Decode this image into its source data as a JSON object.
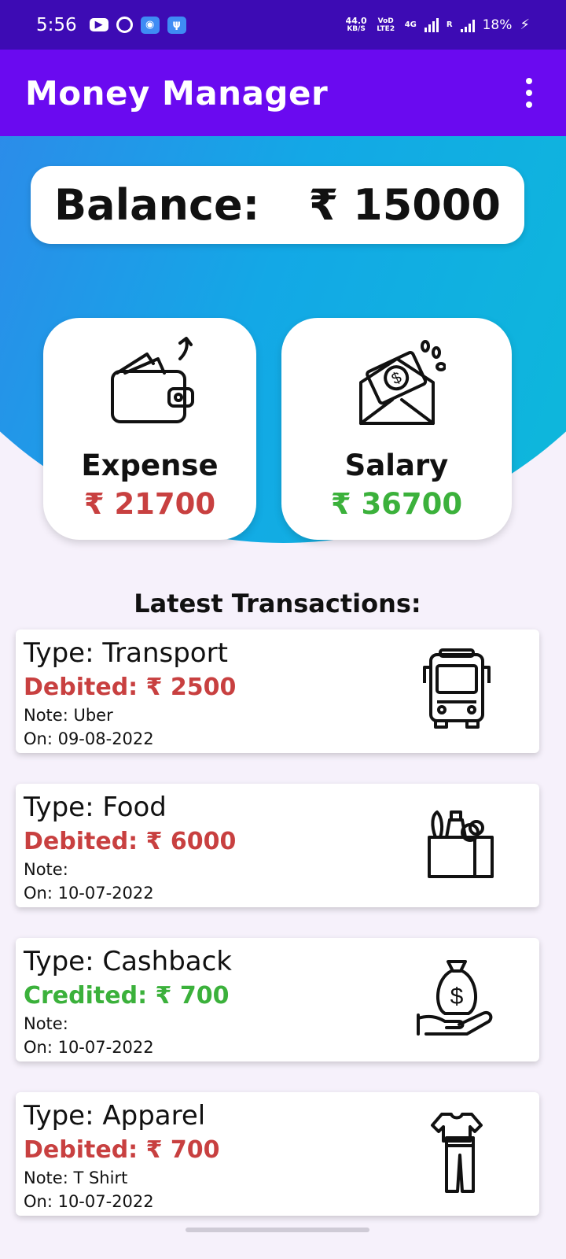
{
  "status_bar": {
    "time": "5:56",
    "net_speed": "44.0",
    "net_unit": "KB/S",
    "volte": "VoD LTE2",
    "net_type": "4G",
    "roaming": "R",
    "battery": "18%"
  },
  "app_bar": {
    "title": "Money Manager",
    "menu_icon": "more-vert-icon"
  },
  "balance": {
    "label": "Balance:",
    "value": "₹ 15000"
  },
  "summary": {
    "expense": {
      "label": "Expense",
      "value": "₹ 21700",
      "icon": "wallet-icon",
      "color": "#c84040"
    },
    "salary": {
      "label": "Salary",
      "value": "₹ 36700",
      "icon": "salary-envelope-icon",
      "color": "#3bb13b"
    }
  },
  "transactions": {
    "title": "Latest Transactions:",
    "items": [
      {
        "type": "Type: Transport",
        "amount": "Debited: ₹ 2500",
        "note": "Note: Uber",
        "date": "On: 09-08-2022",
        "icon": "bus-icon",
        "kind": "debit"
      },
      {
        "type": "Type: Food",
        "amount": "Debited: ₹ 6000",
        "note": "Note:",
        "date": "On: 10-07-2022",
        "icon": "grocery-bag-icon",
        "kind": "debit"
      },
      {
        "type": "Type: Cashback",
        "amount": "Credited: ₹ 700",
        "note": "Note:",
        "date": "On: 10-07-2022",
        "icon": "money-bag-hand-icon",
        "kind": "credit"
      },
      {
        "type": "Type: Apparel",
        "amount": "Debited: ₹ 700",
        "note": "Note: T Shirt",
        "date": "On: 10-07-2022",
        "icon": "clothes-icon",
        "kind": "debit"
      }
    ]
  },
  "colors": {
    "status_bar": "#3d0bb4",
    "app_bar": "#6a0af0",
    "debit": "#c84040",
    "credit": "#3bb13b",
    "background": "#f6f1fb"
  }
}
